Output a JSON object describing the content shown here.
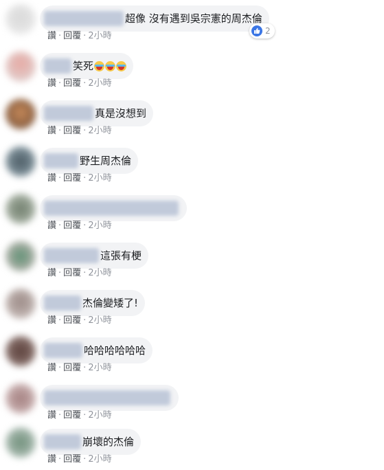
{
  "comments": [
    {
      "text": "超像 沒有遇到吳宗憲的周杰倫",
      "emojis": 0,
      "like": "讚",
      "reply": "回覆",
      "time": "2小時",
      "reactions": "2"
    },
    {
      "text": "笑死",
      "emojis": 3,
      "like": "讚",
      "reply": "回覆",
      "time": "2小時"
    },
    {
      "text": "真是沒想到",
      "emojis": 0,
      "like": "讚",
      "reply": "回覆",
      "time": "2小時"
    },
    {
      "text": "野生周杰倫",
      "emojis": 0,
      "like": "讚",
      "reply": "回覆",
      "time": "2小時"
    },
    {
      "text": "",
      "emojis": 0,
      "like": "讚",
      "reply": "回覆",
      "time": "2小時"
    },
    {
      "text": "這張有梗",
      "emojis": 0,
      "like": "讚",
      "reply": "回覆",
      "time": "2小時"
    },
    {
      "text": "杰倫變矮了!",
      "emojis": 0,
      "like": "讚",
      "reply": "回覆",
      "time": "2小時"
    },
    {
      "text": "哈哈哈哈哈哈",
      "emojis": 0,
      "like": "讚",
      "reply": "回覆",
      "time": "2小時"
    },
    {
      "text": "",
      "emojis": 0,
      "like": "讚",
      "reply": "回覆",
      "time": "2小時"
    },
    {
      "text": "崩壞的杰倫",
      "emojis": 0,
      "like": "讚",
      "reply": "回覆",
      "time": "2小時"
    }
  ],
  "reaction_icon": "like-icon",
  "emoji_icon": "laughing-crying-face-icon",
  "colors": {
    "bubble": "#f2f3f5",
    "like_blue": "#3b76e5",
    "meta_gray": "#90949c"
  }
}
